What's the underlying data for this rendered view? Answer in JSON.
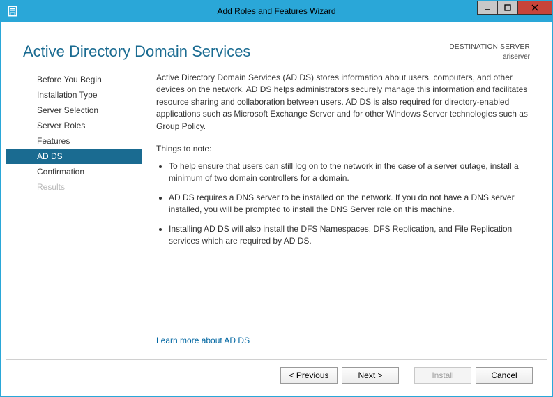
{
  "titlebar": {
    "title": "Add Roles and Features Wizard"
  },
  "header": {
    "page_title": "Active Directory Domain Services",
    "destination_label": "DESTINATION SERVER",
    "destination_value": "ariserver"
  },
  "sidebar": {
    "items": [
      {
        "label": "Before You Begin",
        "state": "normal"
      },
      {
        "label": "Installation Type",
        "state": "normal"
      },
      {
        "label": "Server Selection",
        "state": "normal"
      },
      {
        "label": "Server Roles",
        "state": "normal"
      },
      {
        "label": "Features",
        "state": "normal"
      },
      {
        "label": "AD DS",
        "state": "active"
      },
      {
        "label": "Confirmation",
        "state": "normal"
      },
      {
        "label": "Results",
        "state": "disabled"
      }
    ]
  },
  "main": {
    "intro": "Active Directory Domain Services (AD DS) stores information about users, computers, and other devices on the network.  AD DS helps administrators securely manage this information and facilitates resource sharing and collaboration between users.  AD DS is also required for directory-enabled applications such as Microsoft Exchange Server and for other Windows Server technologies such as Group Policy.",
    "things_label": "Things to note:",
    "notes": [
      "To help ensure that users can still log on to the network in the case of a server outage, install a minimum of two domain controllers for a domain.",
      "AD DS requires a DNS server to be installed on the network.  If you do not have a DNS server installed, you will be prompted to install the DNS Server role on this machine.",
      "Installing AD DS will also install the DFS Namespaces, DFS Replication, and File Replication services which are required by AD DS."
    ],
    "learn_more": "Learn more about AD DS"
  },
  "footer": {
    "previous": "< Previous",
    "next": "Next >",
    "install": "Install",
    "cancel": "Cancel"
  }
}
